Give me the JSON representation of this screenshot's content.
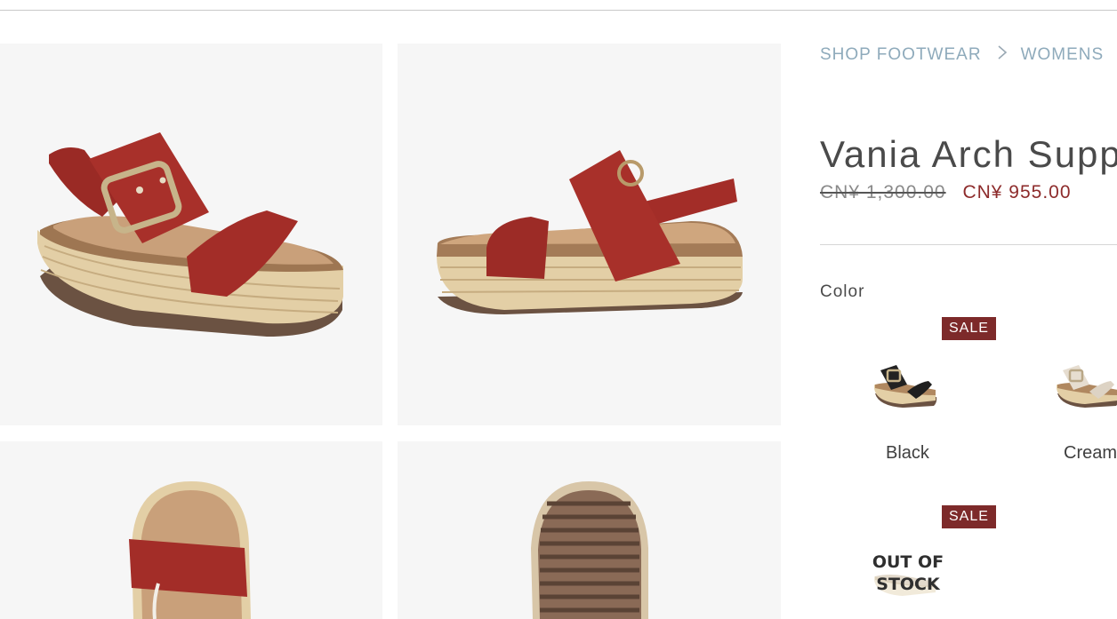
{
  "breadcrumb": {
    "items": [
      "SHOP FOOTWEAR",
      "WOMENS"
    ]
  },
  "product": {
    "title": "Vania Arch Supp",
    "old_price": "CN¥ 1,300.00",
    "sale_price": "CN¥ 955.00"
  },
  "color_section": {
    "label": "Color",
    "swatches": [
      {
        "name": "Black",
        "badge": "SALE",
        "status": ""
      },
      {
        "name": "Cream",
        "badge": "",
        "status": ""
      },
      {
        "name": "",
        "badge": "SALE",
        "status": "OUT OF\nSTOCK"
      }
    ]
  },
  "colors": {
    "sale_red": "#8d2b2b",
    "badge_bg": "#7d2a2a",
    "breadcrumb": "#8eaabb",
    "tile_bg": "#f6f6f6"
  },
  "icons": [
    "chevron-right-icon"
  ]
}
